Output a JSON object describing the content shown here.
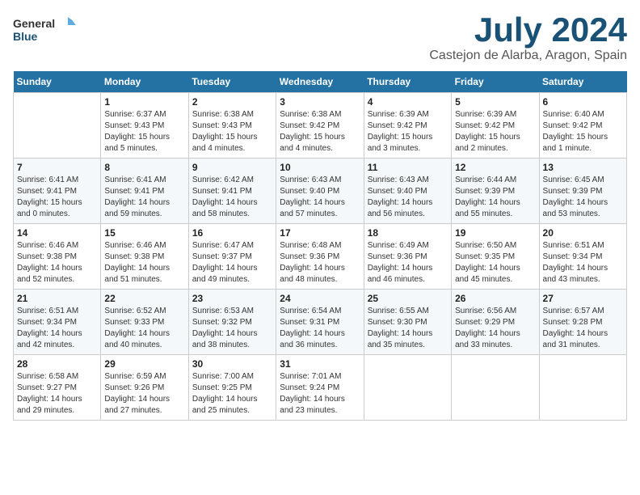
{
  "header": {
    "logo_general": "General",
    "logo_blue": "Blue",
    "month": "July 2024",
    "location": "Castejon de Alarba, Aragon, Spain"
  },
  "days_of_week": [
    "Sunday",
    "Monday",
    "Tuesday",
    "Wednesday",
    "Thursday",
    "Friday",
    "Saturday"
  ],
  "weeks": [
    [
      {
        "day": "",
        "sunrise": "",
        "sunset": "",
        "daylight": ""
      },
      {
        "day": "1",
        "sunrise": "Sunrise: 6:37 AM",
        "sunset": "Sunset: 9:43 PM",
        "daylight": "Daylight: 15 hours and 5 minutes."
      },
      {
        "day": "2",
        "sunrise": "Sunrise: 6:38 AM",
        "sunset": "Sunset: 9:43 PM",
        "daylight": "Daylight: 15 hours and 4 minutes."
      },
      {
        "day": "3",
        "sunrise": "Sunrise: 6:38 AM",
        "sunset": "Sunset: 9:42 PM",
        "daylight": "Daylight: 15 hours and 4 minutes."
      },
      {
        "day": "4",
        "sunrise": "Sunrise: 6:39 AM",
        "sunset": "Sunset: 9:42 PM",
        "daylight": "Daylight: 15 hours and 3 minutes."
      },
      {
        "day": "5",
        "sunrise": "Sunrise: 6:39 AM",
        "sunset": "Sunset: 9:42 PM",
        "daylight": "Daylight: 15 hours and 2 minutes."
      },
      {
        "day": "6",
        "sunrise": "Sunrise: 6:40 AM",
        "sunset": "Sunset: 9:42 PM",
        "daylight": "Daylight: 15 hours and 1 minute."
      }
    ],
    [
      {
        "day": "7",
        "sunrise": "Sunrise: 6:41 AM",
        "sunset": "Sunset: 9:41 PM",
        "daylight": "Daylight: 15 hours and 0 minutes."
      },
      {
        "day": "8",
        "sunrise": "Sunrise: 6:41 AM",
        "sunset": "Sunset: 9:41 PM",
        "daylight": "Daylight: 14 hours and 59 minutes."
      },
      {
        "day": "9",
        "sunrise": "Sunrise: 6:42 AM",
        "sunset": "Sunset: 9:41 PM",
        "daylight": "Daylight: 14 hours and 58 minutes."
      },
      {
        "day": "10",
        "sunrise": "Sunrise: 6:43 AM",
        "sunset": "Sunset: 9:40 PM",
        "daylight": "Daylight: 14 hours and 57 minutes."
      },
      {
        "day": "11",
        "sunrise": "Sunrise: 6:43 AM",
        "sunset": "Sunset: 9:40 PM",
        "daylight": "Daylight: 14 hours and 56 minutes."
      },
      {
        "day": "12",
        "sunrise": "Sunrise: 6:44 AM",
        "sunset": "Sunset: 9:39 PM",
        "daylight": "Daylight: 14 hours and 55 minutes."
      },
      {
        "day": "13",
        "sunrise": "Sunrise: 6:45 AM",
        "sunset": "Sunset: 9:39 PM",
        "daylight": "Daylight: 14 hours and 53 minutes."
      }
    ],
    [
      {
        "day": "14",
        "sunrise": "Sunrise: 6:46 AM",
        "sunset": "Sunset: 9:38 PM",
        "daylight": "Daylight: 14 hours and 52 minutes."
      },
      {
        "day": "15",
        "sunrise": "Sunrise: 6:46 AM",
        "sunset": "Sunset: 9:38 PM",
        "daylight": "Daylight: 14 hours and 51 minutes."
      },
      {
        "day": "16",
        "sunrise": "Sunrise: 6:47 AM",
        "sunset": "Sunset: 9:37 PM",
        "daylight": "Daylight: 14 hours and 49 minutes."
      },
      {
        "day": "17",
        "sunrise": "Sunrise: 6:48 AM",
        "sunset": "Sunset: 9:36 PM",
        "daylight": "Daylight: 14 hours and 48 minutes."
      },
      {
        "day": "18",
        "sunrise": "Sunrise: 6:49 AM",
        "sunset": "Sunset: 9:36 PM",
        "daylight": "Daylight: 14 hours and 46 minutes."
      },
      {
        "day": "19",
        "sunrise": "Sunrise: 6:50 AM",
        "sunset": "Sunset: 9:35 PM",
        "daylight": "Daylight: 14 hours and 45 minutes."
      },
      {
        "day": "20",
        "sunrise": "Sunrise: 6:51 AM",
        "sunset": "Sunset: 9:34 PM",
        "daylight": "Daylight: 14 hours and 43 minutes."
      }
    ],
    [
      {
        "day": "21",
        "sunrise": "Sunrise: 6:51 AM",
        "sunset": "Sunset: 9:34 PM",
        "daylight": "Daylight: 14 hours and 42 minutes."
      },
      {
        "day": "22",
        "sunrise": "Sunrise: 6:52 AM",
        "sunset": "Sunset: 9:33 PM",
        "daylight": "Daylight: 14 hours and 40 minutes."
      },
      {
        "day": "23",
        "sunrise": "Sunrise: 6:53 AM",
        "sunset": "Sunset: 9:32 PM",
        "daylight": "Daylight: 14 hours and 38 minutes."
      },
      {
        "day": "24",
        "sunrise": "Sunrise: 6:54 AM",
        "sunset": "Sunset: 9:31 PM",
        "daylight": "Daylight: 14 hours and 36 minutes."
      },
      {
        "day": "25",
        "sunrise": "Sunrise: 6:55 AM",
        "sunset": "Sunset: 9:30 PM",
        "daylight": "Daylight: 14 hours and 35 minutes."
      },
      {
        "day": "26",
        "sunrise": "Sunrise: 6:56 AM",
        "sunset": "Sunset: 9:29 PM",
        "daylight": "Daylight: 14 hours and 33 minutes."
      },
      {
        "day": "27",
        "sunrise": "Sunrise: 6:57 AM",
        "sunset": "Sunset: 9:28 PM",
        "daylight": "Daylight: 14 hours and 31 minutes."
      }
    ],
    [
      {
        "day": "28",
        "sunrise": "Sunrise: 6:58 AM",
        "sunset": "Sunset: 9:27 PM",
        "daylight": "Daylight: 14 hours and 29 minutes."
      },
      {
        "day": "29",
        "sunrise": "Sunrise: 6:59 AM",
        "sunset": "Sunset: 9:26 PM",
        "daylight": "Daylight: 14 hours and 27 minutes."
      },
      {
        "day": "30",
        "sunrise": "Sunrise: 7:00 AM",
        "sunset": "Sunset: 9:25 PM",
        "daylight": "Daylight: 14 hours and 25 minutes."
      },
      {
        "day": "31",
        "sunrise": "Sunrise: 7:01 AM",
        "sunset": "Sunset: 9:24 PM",
        "daylight": "Daylight: 14 hours and 23 minutes."
      },
      {
        "day": "",
        "sunrise": "",
        "sunset": "",
        "daylight": ""
      },
      {
        "day": "",
        "sunrise": "",
        "sunset": "",
        "daylight": ""
      },
      {
        "day": "",
        "sunrise": "",
        "sunset": "",
        "daylight": ""
      }
    ]
  ]
}
